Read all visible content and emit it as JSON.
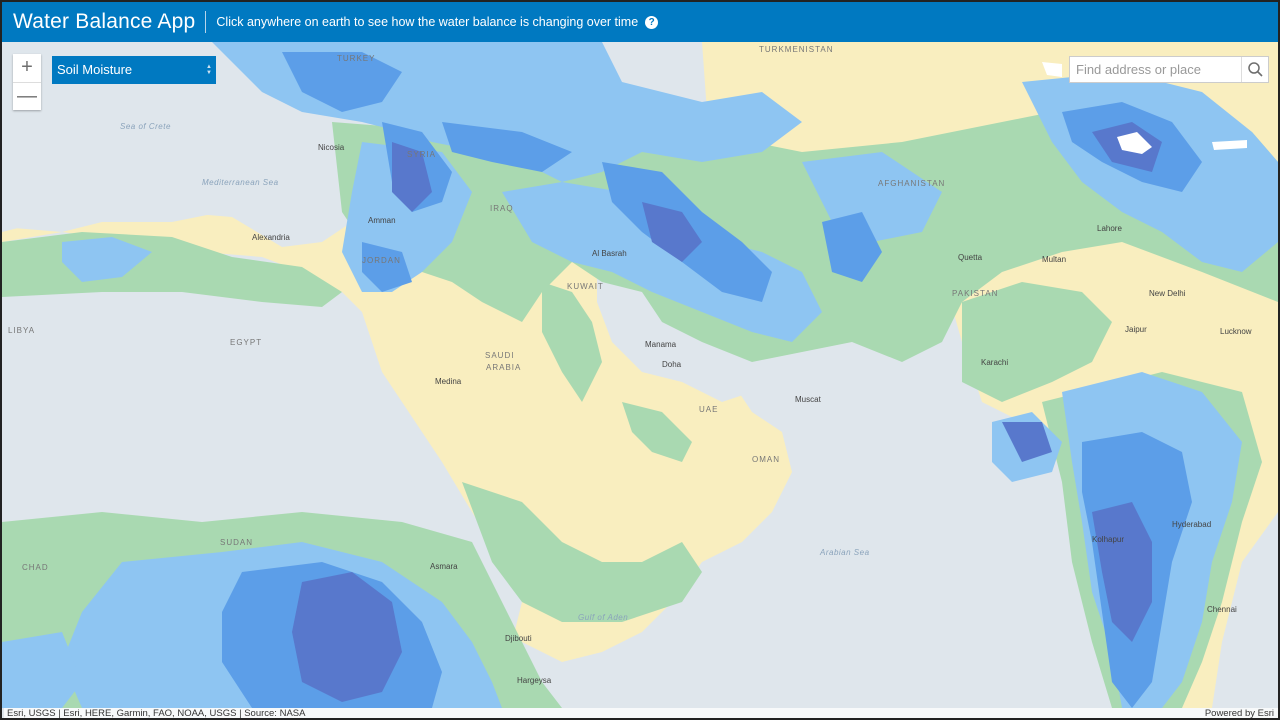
{
  "header": {
    "title": "Water Balance App",
    "subtitle": "Click anywhere on earth to see how the water balance is changing over time",
    "help_glyph": "?"
  },
  "controls": {
    "zoom_in": "+",
    "zoom_out": "—",
    "layer": "Soil Moisture",
    "search_placeholder": "Find address or place"
  },
  "map_labels": {
    "countries": [
      "TURKMENISTAN",
      "TURKEY",
      "SYRIA",
      "IRAQ",
      "JORDAN",
      "KUWAIT",
      "EGYPT",
      "LIBYA",
      "SAUDI",
      "ARABIA",
      "UAE",
      "OMAN",
      "SUDAN",
      "CHAD",
      "AFGHANISTAN",
      "PAKISTAN"
    ],
    "cities": [
      "Nicosia",
      "Alexandria",
      "Amman",
      "Al Basrah",
      "Manama",
      "Doha",
      "Muscat",
      "Medina",
      "Djibouti",
      "Hargeysa",
      "Quetta",
      "Multan",
      "Lahore",
      "New Delhi",
      "Jaipur",
      "Lucknow",
      "Hyderabad",
      "Chennai",
      "Kolhapur",
      "Karachi",
      "Asmara"
    ],
    "seas": [
      "Sea of Crete",
      "Mediterranean Sea",
      "Arabian Sea",
      "Gulf of Aden"
    ]
  },
  "attribution": {
    "credits": "Esri, USGS | Esri, HERE, Garmin, FAO, NOAA, USGS | Source: NASA",
    "powered": "Powered by Esri"
  },
  "colors": {
    "header": "#0079c1",
    "water": "#dfe6ec",
    "dry": "#f9eebf",
    "low": "#a9d9b1",
    "mid": "#8ec5f2",
    "high": "#5c9ee8",
    "very_high": "#5878cc"
  }
}
